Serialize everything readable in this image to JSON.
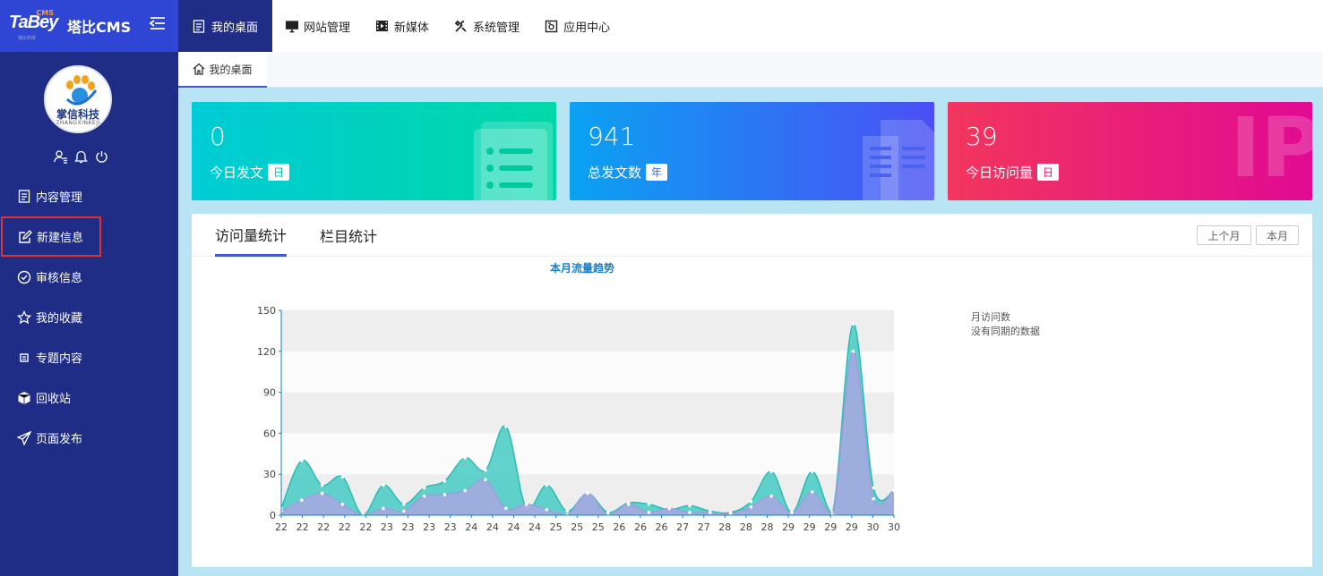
{
  "brand": {
    "logo_text": "TaBey",
    "logo_tag": "CMS",
    "logo_sub": "塔比科技",
    "title": "塔比CMS"
  },
  "user": {
    "company": "掌信科技",
    "company_en": "ZHANGXINKEJI"
  },
  "menu": [
    {
      "label": "内容管理",
      "icon": "document-icon"
    },
    {
      "label": "新建信息",
      "icon": "edit-icon"
    },
    {
      "label": "审核信息",
      "icon": "check-circle-icon"
    },
    {
      "label": "我的收藏",
      "icon": "star-icon"
    },
    {
      "label": "专题内容",
      "icon": "topic-icon"
    },
    {
      "label": "回收站",
      "icon": "box-icon"
    },
    {
      "label": "页面发布",
      "icon": "send-icon"
    }
  ],
  "topnav": [
    {
      "label": "我的桌面",
      "icon": "document-icon"
    },
    {
      "label": "网站管理",
      "icon": "monitor-icon"
    },
    {
      "label": "新媒体",
      "icon": "film-icon"
    },
    {
      "label": "系统管理",
      "icon": "tools-icon"
    },
    {
      "label": "应用中心",
      "icon": "app-icon"
    }
  ],
  "tab": {
    "label": "我的桌面"
  },
  "cards": [
    {
      "value": "0",
      "label": "今日发文",
      "badge": "日"
    },
    {
      "value": "941",
      "label": "总发文数",
      "badge": "年"
    },
    {
      "value": "39",
      "label": "今日访问量",
      "badge": "日",
      "deco_text": "IP"
    }
  ],
  "panel": {
    "tabs": [
      "访问量统计",
      "栏目统计"
    ],
    "buttons": [
      "上个月",
      "本月"
    ]
  },
  "chart_data": {
    "type": "area",
    "title": "本月流量趋势",
    "x": [
      "22",
      "22",
      "22",
      "22",
      "22",
      "23",
      "23",
      "23",
      "23",
      "24",
      "24",
      "24",
      "24",
      "25",
      "25",
      "25",
      "26",
      "26",
      "26",
      "27",
      "27",
      "28",
      "28",
      "28",
      "29",
      "29",
      "29",
      "29",
      "30",
      "30"
    ],
    "ylim": [
      0,
      150
    ],
    "yticks": [
      0,
      30,
      60,
      90,
      120,
      150
    ],
    "grid": "horizontal-bands",
    "legend": {
      "placement": "right",
      "entries": [
        "月访问数",
        "没有同期的数据"
      ]
    },
    "series": [
      {
        "name": "月访问数",
        "color": "#3cc8c0",
        "values": [
          5,
          40,
          22,
          28,
          0,
          22,
          8,
          20,
          25,
          42,
          33,
          65,
          5,
          22,
          3,
          16,
          2,
          9,
          8,
          4,
          7,
          3,
          2,
          10,
          32,
          2,
          32,
          2,
          140,
          20,
          18
        ]
      },
      {
        "name": "",
        "color": "#a3a9e0",
        "values": [
          3,
          11,
          16,
          8,
          0,
          5,
          3,
          14,
          15,
          18,
          26,
          5,
          8,
          4,
          0,
          16,
          0,
          8,
          2,
          5,
          2,
          2,
          1,
          6,
          14,
          2,
          17,
          0,
          120,
          12,
          18
        ]
      }
    ]
  }
}
